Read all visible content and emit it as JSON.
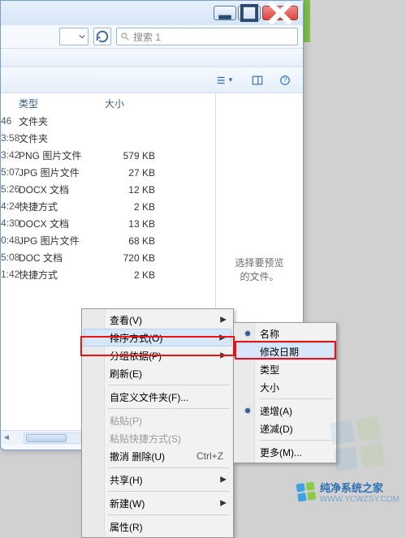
{
  "window": {
    "search_placeholder": "搜索 1"
  },
  "columns": {
    "type": "类型",
    "size": "大小"
  },
  "rows": [
    {
      "time": "46",
      "type": "文件夹",
      "size": ""
    },
    {
      "time": "3:58",
      "type": "文件夹",
      "size": ""
    },
    {
      "time": "3:42",
      "type": "PNG 图片文件",
      "size": "579 KB"
    },
    {
      "time": "5:07",
      "type": "JPG 图片文件",
      "size": "27 KB"
    },
    {
      "time": "5:26",
      "type": "DOCX 文档",
      "size": "12 KB"
    },
    {
      "time": "4:24",
      "type": "快捷方式",
      "size": "2 KB"
    },
    {
      "time": "4:30",
      "type": "DOCX 文档",
      "size": "13 KB"
    },
    {
      "time": "0:48",
      "type": "JPG 图片文件",
      "size": "68 KB"
    },
    {
      "time": "5:08",
      "type": "DOC 文档",
      "size": "720 KB"
    },
    {
      "time": "1:42",
      "type": "快捷方式",
      "size": "2 KB"
    }
  ],
  "preview": {
    "line1": "选择要预览",
    "line2": "的文件。"
  },
  "context_menu": {
    "view": "查看(V)",
    "sort_by": "排序方式(O)",
    "group_by": "分组依据(P)",
    "refresh": "刷新(E)",
    "customize": "自定义文件夹(F)...",
    "paste": "粘贴(P)",
    "paste_shortcut": "粘贴快捷方式(S)",
    "undo_delete": "撤消 删除(U)",
    "undo_shortcut": "Ctrl+Z",
    "share": "共享(H)",
    "new": "新建(W)",
    "properties": "属性(R)"
  },
  "sort_submenu": {
    "name": "名称",
    "date_modified": "修改日期",
    "type": "类型",
    "size": "大小",
    "ascending": "递增(A)",
    "descending": "递减(D)",
    "more": "更多(M)..."
  },
  "watermark": {
    "title": "纯净系统之家",
    "url": "WWW.YCWZSY.COM"
  }
}
